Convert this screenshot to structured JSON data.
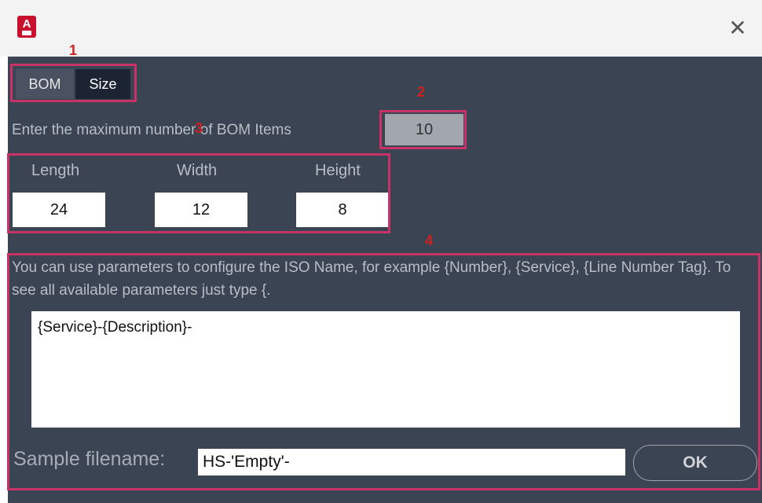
{
  "window": {
    "app_icon": "autocad-icon",
    "app_icon_letter": "A",
    "close_glyph": "✕"
  },
  "tabs": [
    {
      "label": "BOM",
      "selected": false
    },
    {
      "label": "Size",
      "selected": true
    }
  ],
  "bom": {
    "max_items_label": "Enter the maximum number of BOM Items",
    "max_items_value": "10"
  },
  "size": {
    "length_label": "Length",
    "width_label": "Width",
    "height_label": "Height",
    "length_value": "24",
    "width_value": "12",
    "height_value": "8"
  },
  "iso_name": {
    "description": "You can use parameters to configure the ISO Name, for example {Number}, {Service}, {Line Number Tag}.  To see all available parameters just type {.",
    "template": "{Service}-{Description}-"
  },
  "sample": {
    "label": "Sample filename:",
    "value": "HS-'Empty'-"
  },
  "ok_label": "OK",
  "annotations": [
    "1",
    "2",
    "3",
    "4"
  ],
  "colors": {
    "annotation_box": "#c83266",
    "annotation_number": "#d22020",
    "dialog_background": "#3b4453"
  }
}
